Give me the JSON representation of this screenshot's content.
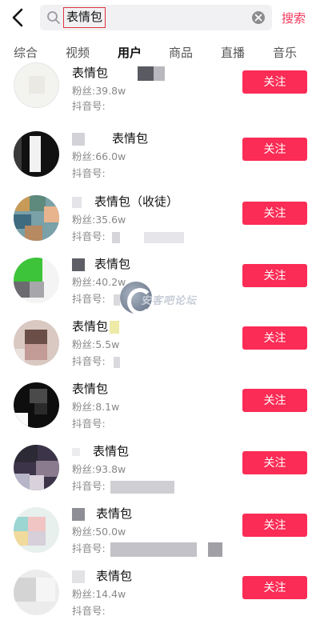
{
  "header": {
    "search_query": "表情包",
    "search_button": "搜索"
  },
  "tabs": [
    {
      "label": "综合"
    },
    {
      "label": "视频"
    },
    {
      "label": "用户"
    },
    {
      "label": "商品"
    },
    {
      "label": "直播"
    },
    {
      "label": "音乐"
    }
  ],
  "active_tab": "用户",
  "users": [
    {
      "name": "表情包",
      "fans": "粉丝:39.8w",
      "id": "抖音号:",
      "follow": "关注"
    },
    {
      "name": "表情包",
      "fans": "粉丝:66.0w",
      "id": "抖音号:",
      "follow": "关注"
    },
    {
      "name": "表情包（收徒）",
      "fans": "粉丝:35.6w",
      "id": "抖音号:",
      "follow": "关注"
    },
    {
      "name": "表情包",
      "fans": "粉丝:40.2w",
      "id": "抖音号:",
      "follow": "关注"
    },
    {
      "name": "表情包",
      "fans": "粉丝:5.5w",
      "id": "抖音号:",
      "follow": "关注"
    },
    {
      "name": "表情包",
      "fans": "粉丝:8.1w",
      "id": "抖音号:",
      "follow": "关注"
    },
    {
      "name": "表情包",
      "fans": "粉丝:93.8w",
      "id": "抖音号:",
      "follow": "关注"
    },
    {
      "name": "表情包",
      "fans": "粉丝:50.0w",
      "id": "抖音号:",
      "follow": "关注"
    },
    {
      "name": "表情包",
      "fans": "粉丝:14.4w",
      "id": "抖音号:",
      "follow": "关注"
    }
  ],
  "watermark": "安客吧论坛",
  "colors": {
    "accent": "#fb2c55",
    "search_button": "#f1385b",
    "highlight_box": "#e0333f"
  }
}
